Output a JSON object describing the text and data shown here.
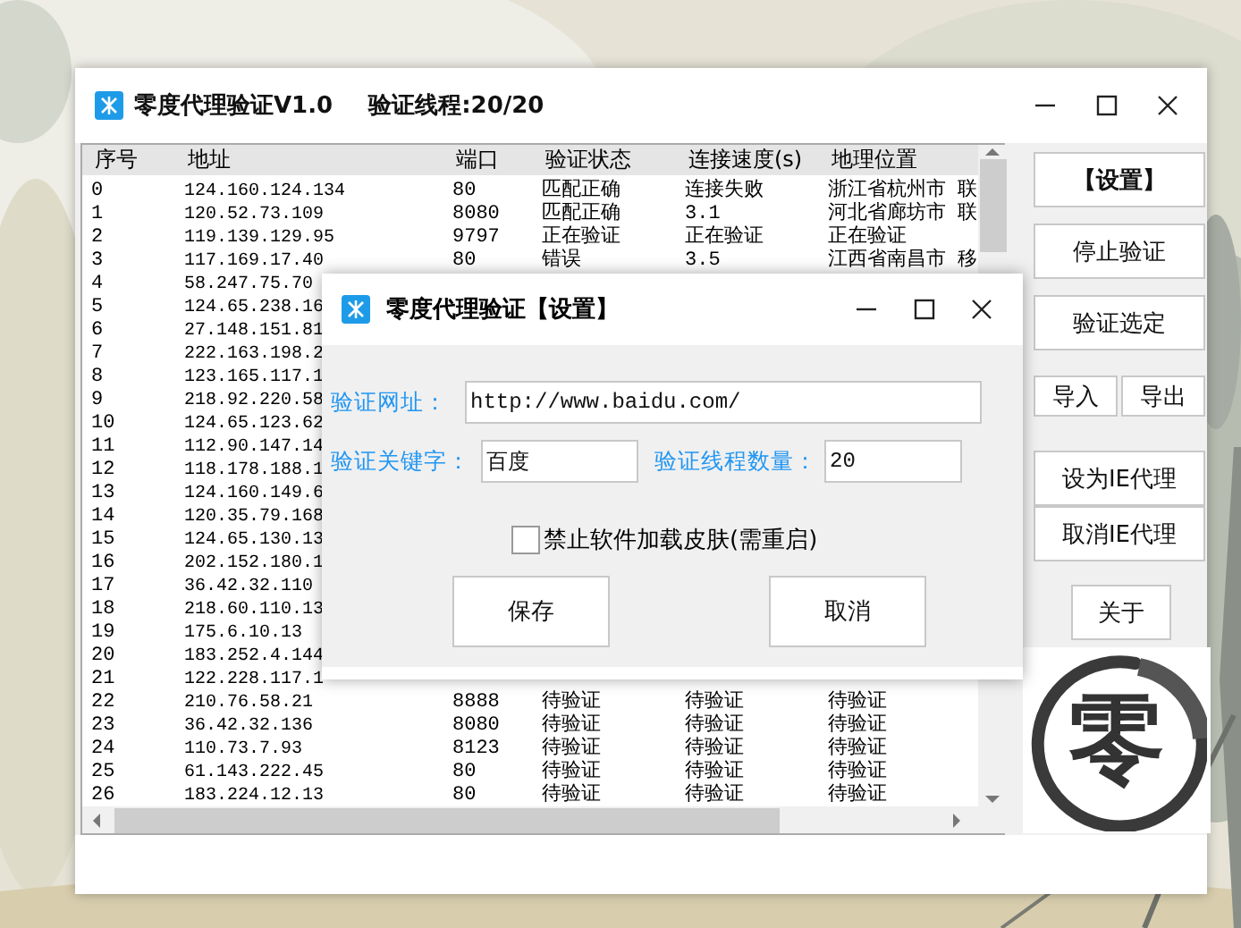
{
  "window": {
    "title": "零度代理验证V1.0",
    "thread_status": "验证线程:20/20"
  },
  "table": {
    "columns": [
      "序号",
      "地址",
      "端口",
      "验证状态",
      "连接速度(s)",
      "地理位置"
    ],
    "rows": [
      {
        "cells": [
          "0",
          "124.160.124.134",
          "80",
          "匹配正确",
          "连接失败",
          "浙江省杭州市 联"
        ]
      },
      {
        "cells": [
          "1",
          "120.52.73.109",
          "8080",
          "匹配正确",
          "3.1",
          "河北省廊坊市 联"
        ]
      },
      {
        "cells": [
          "2",
          "119.139.129.95",
          "9797",
          "正在验证",
          "正在验证",
          "正在验证"
        ]
      },
      {
        "cells": [
          "3",
          "117.169.17.40",
          "80",
          "错误",
          "3.5",
          "江西省南昌市 移"
        ]
      },
      {
        "cells": [
          "4",
          "58.247.75.70"
        ]
      },
      {
        "cells": [
          "5",
          "124.65.238.16"
        ]
      },
      {
        "cells": [
          "6",
          "27.148.151.81"
        ]
      },
      {
        "cells": [
          "7",
          "222.163.198.2"
        ]
      },
      {
        "cells": [
          "8",
          "123.165.117.1"
        ]
      },
      {
        "cells": [
          "9",
          "218.92.220.58"
        ]
      },
      {
        "cells": [
          "10",
          "124.65.123.62"
        ]
      },
      {
        "cells": [
          "11",
          "112.90.147.14"
        ]
      },
      {
        "cells": [
          "12",
          "118.178.188.1"
        ]
      },
      {
        "cells": [
          "13",
          "124.160.149.6"
        ]
      },
      {
        "cells": [
          "14",
          "120.35.79.168"
        ]
      },
      {
        "cells": [
          "15",
          "124.65.130.13"
        ]
      },
      {
        "cells": [
          "16",
          "202.152.180.1"
        ]
      },
      {
        "cells": [
          "17",
          "36.42.32.110"
        ]
      },
      {
        "cells": [
          "18",
          "218.60.110.13"
        ]
      },
      {
        "cells": [
          "19",
          "175.6.10.13"
        ]
      },
      {
        "cells": [
          "20",
          "183.252.4.144"
        ]
      },
      {
        "cells": [
          "21",
          "122.228.117.1"
        ]
      },
      {
        "cells": [
          "22",
          "210.76.58.21",
          "8888",
          "待验证",
          "待验证",
          "待验证"
        ]
      },
      {
        "cells": [
          "23",
          "36.42.32.136",
          "8080",
          "待验证",
          "待验证",
          "待验证"
        ]
      },
      {
        "cells": [
          "24",
          "110.73.7.93",
          "8123",
          "待验证",
          "待验证",
          "待验证"
        ]
      },
      {
        "cells": [
          "25",
          "61.143.222.45",
          "80",
          "待验证",
          "待验证",
          "待验证"
        ]
      },
      {
        "cells": [
          "26",
          "183.224.12.13",
          "80",
          "待验证",
          "待验证",
          "待验证"
        ]
      }
    ]
  },
  "side_buttons": [
    {
      "label": "【设置】",
      "kind": "wide",
      "bold": true
    },
    {
      "label": "停止验证",
      "kind": "wide",
      "bold": false
    },
    {
      "label": "验证选定",
      "kind": "wide",
      "bold": false
    },
    {
      "label": "导入",
      "kind": "half",
      "bold": false
    },
    {
      "label": "导出",
      "kind": "half",
      "bold": false
    },
    {
      "label": "设为IE代理",
      "kind": "wide",
      "bold": false
    },
    {
      "label": "取消IE代理",
      "kind": "wide",
      "bold": false
    },
    {
      "label": "关于",
      "kind": "small",
      "bold": false
    }
  ],
  "logo": {
    "text": "零"
  },
  "dialog": {
    "title": "零度代理验证【设置】",
    "fields": [
      {
        "label": "验证网址：",
        "value": "http://www.baidu.com/",
        "kind": "long"
      },
      {
        "label": "验证关键字：",
        "value": "百度",
        "kind": "short"
      },
      {
        "label": "验证线程数量：",
        "value": "20",
        "kind": "short"
      }
    ],
    "checkbox": {
      "label": "禁止软件加载皮肤(需重启)",
      "checked": false
    },
    "buttons": [
      "保存",
      "取消"
    ]
  }
}
